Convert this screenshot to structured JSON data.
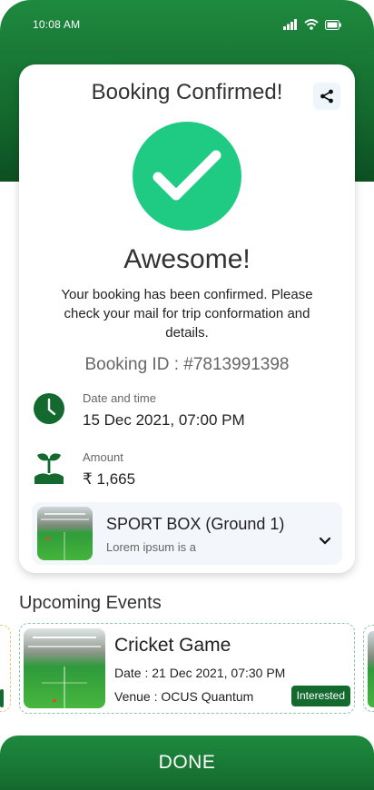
{
  "status_bar": {
    "time": "10:08 AM",
    "icons": [
      "signal-icon",
      "wifi-icon",
      "battery-icon"
    ]
  },
  "card": {
    "title": "Booking Confirmed!",
    "share_icon": "share-icon",
    "success_icon": "check-icon",
    "headline": "Awesome!",
    "message": "Your booking has been confirmed. Please check your mail for trip conformation and details.",
    "booking_id": "Booking ID : #7813991398",
    "datetime": {
      "icon": "clock-icon",
      "label": "Date and time",
      "value": "15 Dec 2021, 07:00 PM"
    },
    "amount": {
      "icon": "plant-icon",
      "label": "Amount",
      "value": "₹ 1,665"
    },
    "venue": {
      "name": "SPORT BOX (Ground 1)",
      "subtitle": "Lorem ipsum is a",
      "expand_icon": "chevron-down-icon"
    }
  },
  "upcoming": {
    "title": "Upcoming Events",
    "events": [
      {
        "title": "Cricket Game",
        "date": "Date : 21 Dec 2021, 07:30 PM",
        "venue": "Venue : OCUS Quantum",
        "action": "Interested"
      }
    ]
  },
  "done_label": "DONE",
  "colors": {
    "primary": "#146a2e",
    "success": "#1fcb83",
    "card_bg": "#ffffff",
    "venue_bg": "#f3f6fb"
  }
}
